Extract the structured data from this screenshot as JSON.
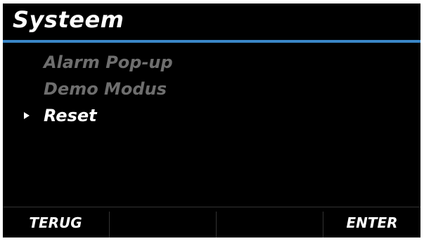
{
  "header": {
    "title": "Systeem"
  },
  "menu": {
    "items": [
      {
        "label": "Alarm Pop-up",
        "state": "dimmed"
      },
      {
        "label": "Demo Modus",
        "state": "dimmed"
      },
      {
        "label": "Reset",
        "state": "selected"
      }
    ],
    "pointer_icon": "triangle-right-icon"
  },
  "softkeys": {
    "left_label": "TERUG",
    "right_label": "ENTER"
  },
  "colors": {
    "background": "#000000",
    "accent": "#3a87c8",
    "text_active": "#ffffff",
    "text_dimmed": "#6e6e6e"
  }
}
